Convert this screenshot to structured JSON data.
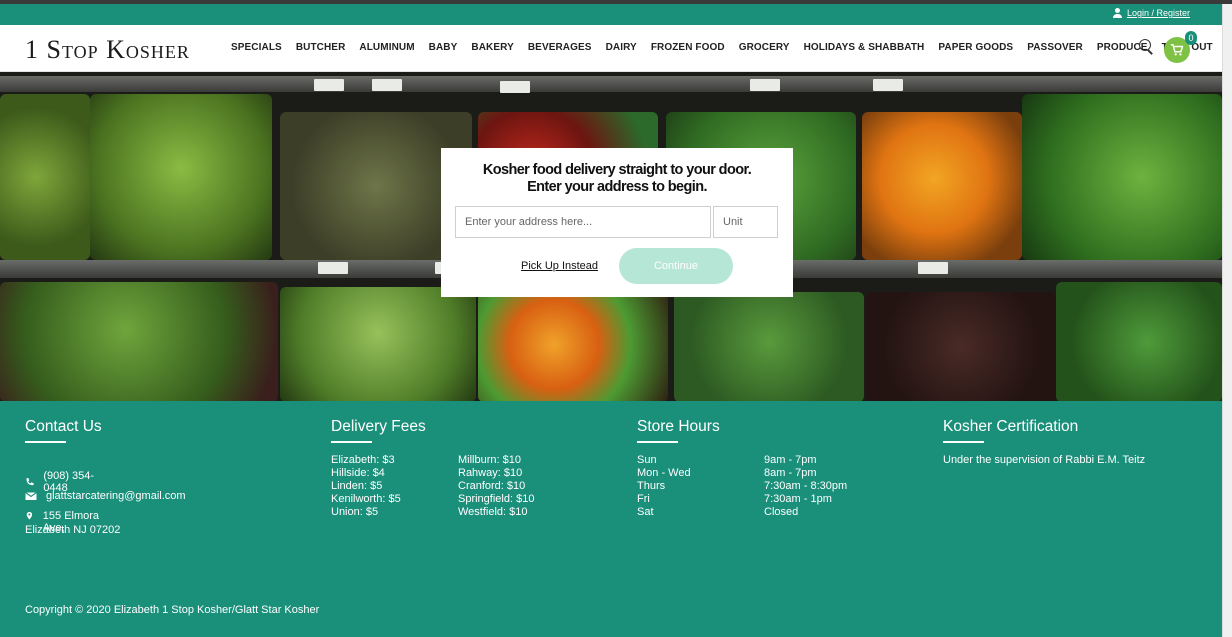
{
  "topbar": {
    "login_label": "Login / Register"
  },
  "header": {
    "logo": "1 Stop Kosher",
    "nav": [
      "SPECIALS",
      "BUTCHER",
      "ALUMINUM",
      "BABY",
      "BAKERY",
      "BEVERAGES",
      "DAIRY",
      "FROZEN FOOD",
      "GROCERY",
      "HOLIDAYS & SHABBATH",
      "PAPER GOODS",
      "PASSOVER",
      "PRODUCE",
      "TAKE OUT"
    ],
    "cart_count": "0"
  },
  "modal": {
    "heading_line1": "Kosher food delivery straight to your door.",
    "heading_line2": "Enter your address to begin.",
    "address_placeholder": "Enter your address here...",
    "unit_placeholder": "Unit",
    "pickup_label": "Pick Up Instead",
    "continue_label": "Continue"
  },
  "footer": {
    "contact": {
      "title": "Contact Us",
      "phone": "(908) 354-0448",
      "email": "glattstarcatering@gmail.com",
      "address_line1": "155 Elmora Ave,",
      "address_line2": "Elizabeth NJ 07202"
    },
    "delivery": {
      "title": "Delivery Fees",
      "left": [
        "Elizabeth: $3",
        "Hillside: $4",
        "Linden: $5",
        "Kenilworth: $5",
        "Union: $5"
      ],
      "right": [
        "Millburn: $10",
        "Rahway: $10",
        "Cranford: $10",
        "Springfield: $10",
        "Westfield: $10"
      ]
    },
    "hours": {
      "title": "Store Hours",
      "days": [
        "Sun",
        "Mon - Wed",
        "Thurs",
        "Fri",
        "Sat"
      ],
      "times": [
        "9am - 7pm",
        "8am - 7pm",
        "7:30am - 8:30pm",
        "7:30am - 1pm",
        "Closed"
      ]
    },
    "cert": {
      "title": "Kosher Certification",
      "text": "Under the supervision of Rabbi E.M. Teitz"
    },
    "copyright": "Copyright © 2020 Elizabeth 1 Stop Kosher/Glatt Star Kosher"
  },
  "colors": {
    "brand_teal": "#1a8f7a",
    "cart_green": "#7fc144",
    "continue_disabled": "#b6e6d6"
  }
}
